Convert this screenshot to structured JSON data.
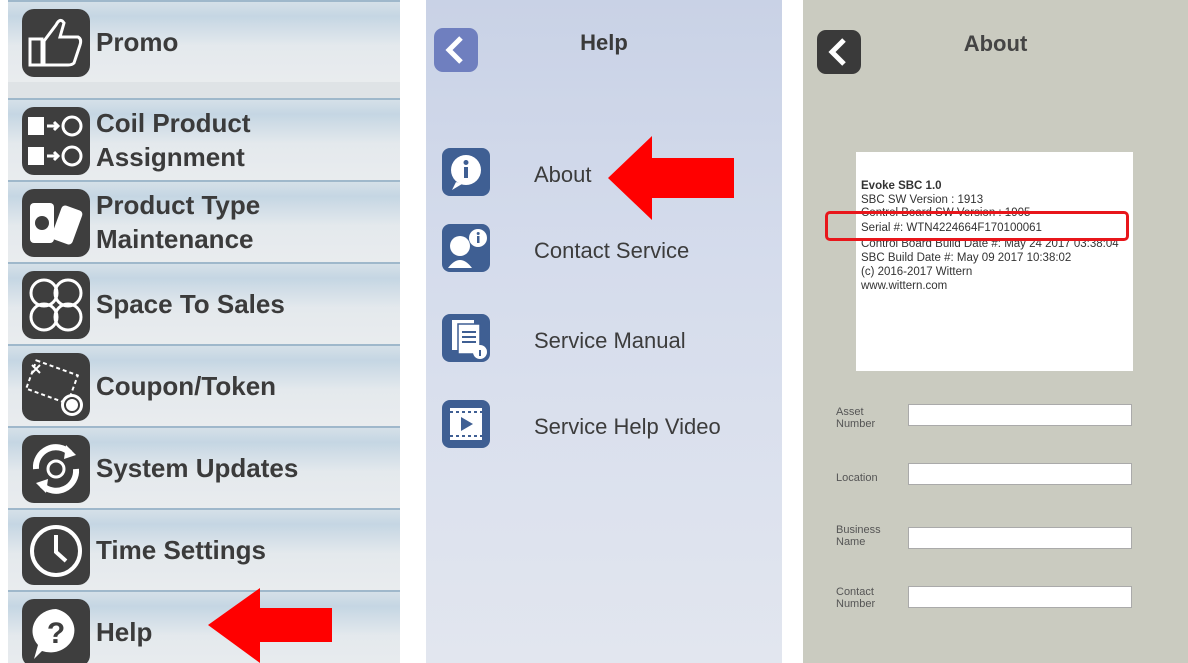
{
  "colors": {
    "highlight_red": "#ff0000",
    "icon_dark": "#3e3e3e",
    "help_icon_blue": "#3f5f93",
    "back_button": "#6f7fbf"
  },
  "menu": {
    "items": [
      {
        "label": "Promo",
        "icon": "thumbs-up-icon"
      },
      {
        "label": "Coil Product\nAssignment",
        "icon": "coil-assignment-icon"
      },
      {
        "label": "Product Type\nMaintenance",
        "icon": "product-type-icon"
      },
      {
        "label": "Space To Sales",
        "icon": "space-to-sales-icon"
      },
      {
        "label": "Coupon/Token",
        "icon": "coupon-icon"
      },
      {
        "label": "System Updates",
        "icon": "system-updates-icon"
      },
      {
        "label": "Time Settings",
        "icon": "clock-icon"
      },
      {
        "label": "Help",
        "icon": "help-icon"
      }
    ]
  },
  "help": {
    "title": "Help",
    "items": [
      {
        "label": "About",
        "icon": "info-icon"
      },
      {
        "label": "Contact Service",
        "icon": "contact-service-icon"
      },
      {
        "label": "Service Manual",
        "icon": "manual-icon"
      },
      {
        "label": "Service Help Video",
        "icon": "video-icon"
      }
    ]
  },
  "about": {
    "title": "About",
    "info": {
      "product": "Evoke SBC 1.0",
      "sbc_sw_version": "SBC SW Version : 1913",
      "control_board_sw_version": "Control Board SW Version : 1905",
      "serial": "Serial #: WTN4224664F170100061",
      "control_board_build_date": "Control Board Build Date #: May 24 2017 03:38:04",
      "sbc_build_date": "SBC Build Date #: May 09 2017 10:38:02",
      "copyright": "(c) 2016-2017 Wittern",
      "website": "www.wittern.com"
    },
    "fields": [
      {
        "label": "Asset\nNumber",
        "value": ""
      },
      {
        "label": "Location",
        "value": ""
      },
      {
        "label": "Business\nName",
        "value": ""
      },
      {
        "label": "Contact\nNumber",
        "value": ""
      }
    ]
  }
}
